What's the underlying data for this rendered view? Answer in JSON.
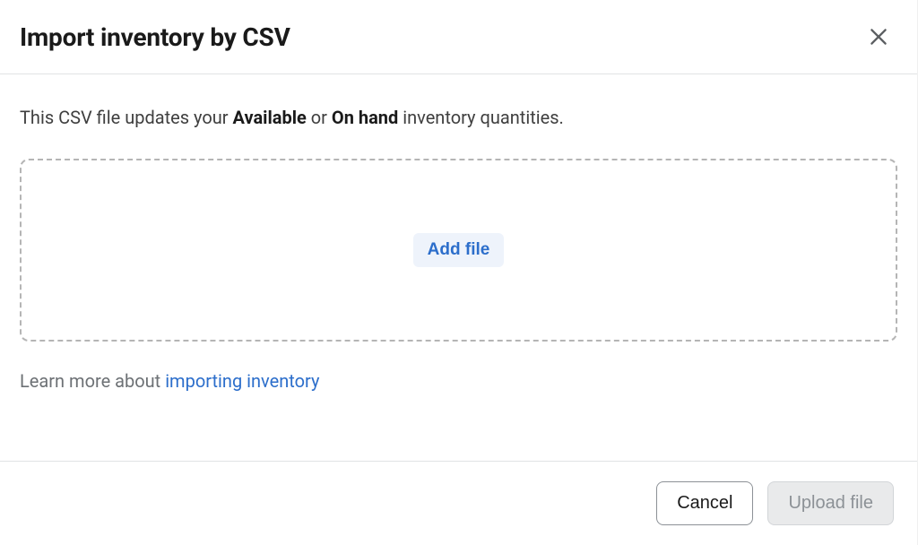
{
  "header": {
    "title": "Import inventory by CSV"
  },
  "body": {
    "description_prefix": "This CSV file updates your ",
    "description_bold1": "Available",
    "description_mid": " or ",
    "description_bold2": "On hand",
    "description_suffix": " inventory quantities.",
    "add_file_label": "Add file",
    "learn_more_prefix": "Learn more about ",
    "learn_more_link": "importing inventory"
  },
  "footer": {
    "cancel_label": "Cancel",
    "upload_label": "Upload file"
  }
}
